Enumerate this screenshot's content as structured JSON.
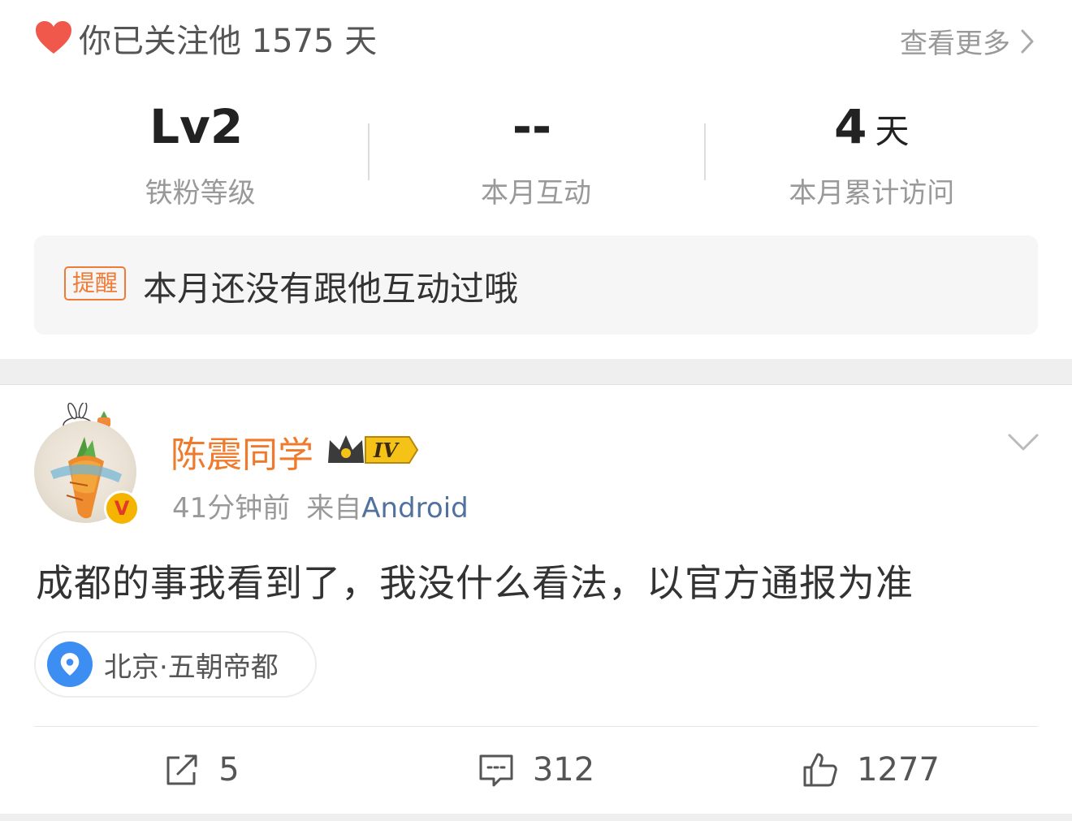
{
  "follow": {
    "text": "你已关注他 1575 天",
    "see_more": "查看更多"
  },
  "stats": [
    {
      "value": "Lv2",
      "unit": "",
      "label": "铁粉等级"
    },
    {
      "value": "--",
      "unit": "",
      "label": "本月互动"
    },
    {
      "value": "4",
      "unit": "天",
      "label": "本月累计访问"
    }
  ],
  "reminder": {
    "tag": "提醒",
    "text": "本月还没有跟他互动过哦"
  },
  "post": {
    "author": "陈震同学",
    "vip_level": "IV",
    "verify_mark": "V",
    "time": "41分钟前",
    "source_prefix": "来自",
    "source": "Android",
    "body": "成都的事我看到了，我没什么看法，以官方通报为准",
    "location": "北京·五朝帝都"
  },
  "actions": {
    "repost_count": "5",
    "comment_count": "312",
    "like_count": "1277"
  },
  "colors": {
    "accent_orange": "#f07a2c",
    "link_blue": "#51719e",
    "pin_blue": "#3d8ef3",
    "heart_red": "#f0584c"
  },
  "icons": [
    "heart-icon",
    "chevron-right-icon",
    "chevron-down-icon",
    "location-pin-icon",
    "repost-icon",
    "comment-icon",
    "like-icon",
    "vip-crown-icon"
  ]
}
